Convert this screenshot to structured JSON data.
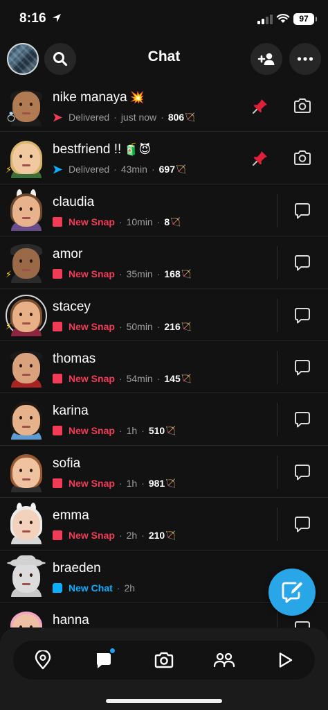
{
  "status_bar": {
    "time": "8:16",
    "battery": "97"
  },
  "header": {
    "title": "Chat"
  },
  "chats": [
    {
      "name": "nike manaya",
      "emoji": "💥",
      "indicator": "sent-red",
      "status": "Delivered",
      "status_style": "grey",
      "time": "just now",
      "streak": "806",
      "pinned": true,
      "action": "camera",
      "avatar": "boy-dark",
      "badge": "💍"
    },
    {
      "name": "bestfriend !!",
      "emoji": "🧃😈",
      "indicator": "sent-blue",
      "status": "Delivered",
      "status_style": "grey",
      "time": "43min",
      "streak": "697",
      "pinned": true,
      "action": "camera",
      "avatar": "girl-blonde",
      "badge": "⚡"
    },
    {
      "name": "claudia",
      "emoji": "",
      "indicator": "snap",
      "status": "New Snap",
      "status_style": "red",
      "time": "10min",
      "streak": "8",
      "pinned": false,
      "action": "chat",
      "avatar": "girl-bunny",
      "badge": ""
    },
    {
      "name": "amor",
      "emoji": "",
      "indicator": "snap",
      "status": "New Snap",
      "status_style": "red",
      "time": "35min",
      "streak": "168",
      "pinned": false,
      "action": "chat",
      "avatar": "boy-crown",
      "badge": "⚡"
    },
    {
      "name": "stacey",
      "emoji": "",
      "indicator": "snap",
      "status": "New Snap",
      "status_style": "red",
      "time": "50min",
      "streak": "216",
      "pinned": false,
      "action": "chat",
      "avatar": "girl-hearts",
      "badge": "⚡"
    },
    {
      "name": "thomas",
      "emoji": "",
      "indicator": "snap",
      "status": "New Snap",
      "status_style": "red",
      "time": "54min",
      "streak": "145",
      "pinned": false,
      "action": "chat",
      "avatar": "boy-glasses",
      "badge": ""
    },
    {
      "name": "karina",
      "emoji": "",
      "indicator": "snap",
      "status": "New Snap",
      "status_style": "red",
      "time": "1h",
      "streak": "510",
      "pinned": false,
      "action": "chat",
      "avatar": "girl-dark",
      "badge": ""
    },
    {
      "name": "sofia",
      "emoji": "",
      "indicator": "snap",
      "status": "New Snap",
      "status_style": "red",
      "time": "1h",
      "streak": "981",
      "pinned": false,
      "action": "chat",
      "avatar": "girl-auburn",
      "badge": ""
    },
    {
      "name": "emma",
      "emoji": "",
      "indicator": "snap",
      "status": "New Snap",
      "status_style": "red",
      "time": "2h",
      "streak": "210",
      "pinned": false,
      "action": "chat",
      "avatar": "girl-bunny-white",
      "badge": ""
    },
    {
      "name": "braeden",
      "emoji": "",
      "indicator": "chat",
      "status": "New Chat",
      "status_style": "blue",
      "time": "2h",
      "streak": "",
      "pinned": false,
      "action": "none",
      "avatar": "boy-cowboy",
      "badge": ""
    },
    {
      "name": "hanna",
      "emoji": "",
      "indicator": "",
      "status": "",
      "status_style": "grey",
      "time": "",
      "streak": "",
      "pinned": false,
      "action": "chat",
      "avatar": "girl-pink",
      "badge": ""
    }
  ],
  "bottom_nav": [
    "map-icon",
    "chat-icon",
    "camera-icon",
    "friends-icon",
    "spotlight-icon"
  ],
  "colors": {
    "snap_red": "#f23c57",
    "chat_blue": "#0eadff",
    "fab_blue": "#28a6e8",
    "background": "#121212"
  }
}
